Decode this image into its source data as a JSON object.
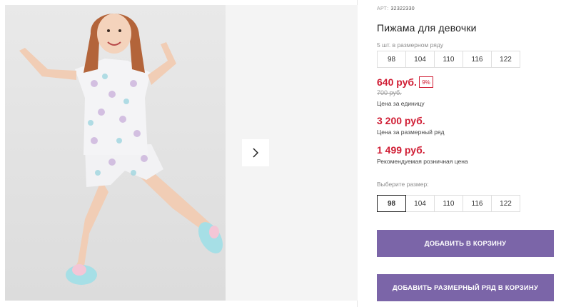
{
  "gallery": {
    "photo_alt": "",
    "next_icon": "chevron-right-icon"
  },
  "product": {
    "art_label": "АРТ:",
    "art_value": "32322330",
    "title": "Пижама для девочки"
  },
  "size_row": {
    "label": "5 шт. в размерном ряду",
    "sizes": [
      "98",
      "104",
      "110",
      "116",
      "122"
    ]
  },
  "prices": {
    "unit_price": "640 руб.",
    "discount_badge": "9%",
    "old_price": "700 руб.",
    "unit_caption": "Цена за единицу",
    "row_price": "3 200 руб.",
    "row_caption": "Цена за размерный ряд",
    "rrp_price": "1 499 руб.",
    "rrp_caption": "Рекомендуемая розничная цена"
  },
  "size_picker": {
    "label": "Выберите размер:",
    "sizes": [
      "98",
      "104",
      "110",
      "116",
      "122"
    ],
    "selected": "98"
  },
  "actions": {
    "add_to_cart": "ДОБАВИТЬ В КОРЗИНУ",
    "add_row_to_cart": "ДОБАВИТЬ РАЗМЕРНЫЙ РЯД В КОРЗИНУ"
  },
  "colors": {
    "accent_red": "#d01d34",
    "button_purple": "#7b65a8"
  }
}
